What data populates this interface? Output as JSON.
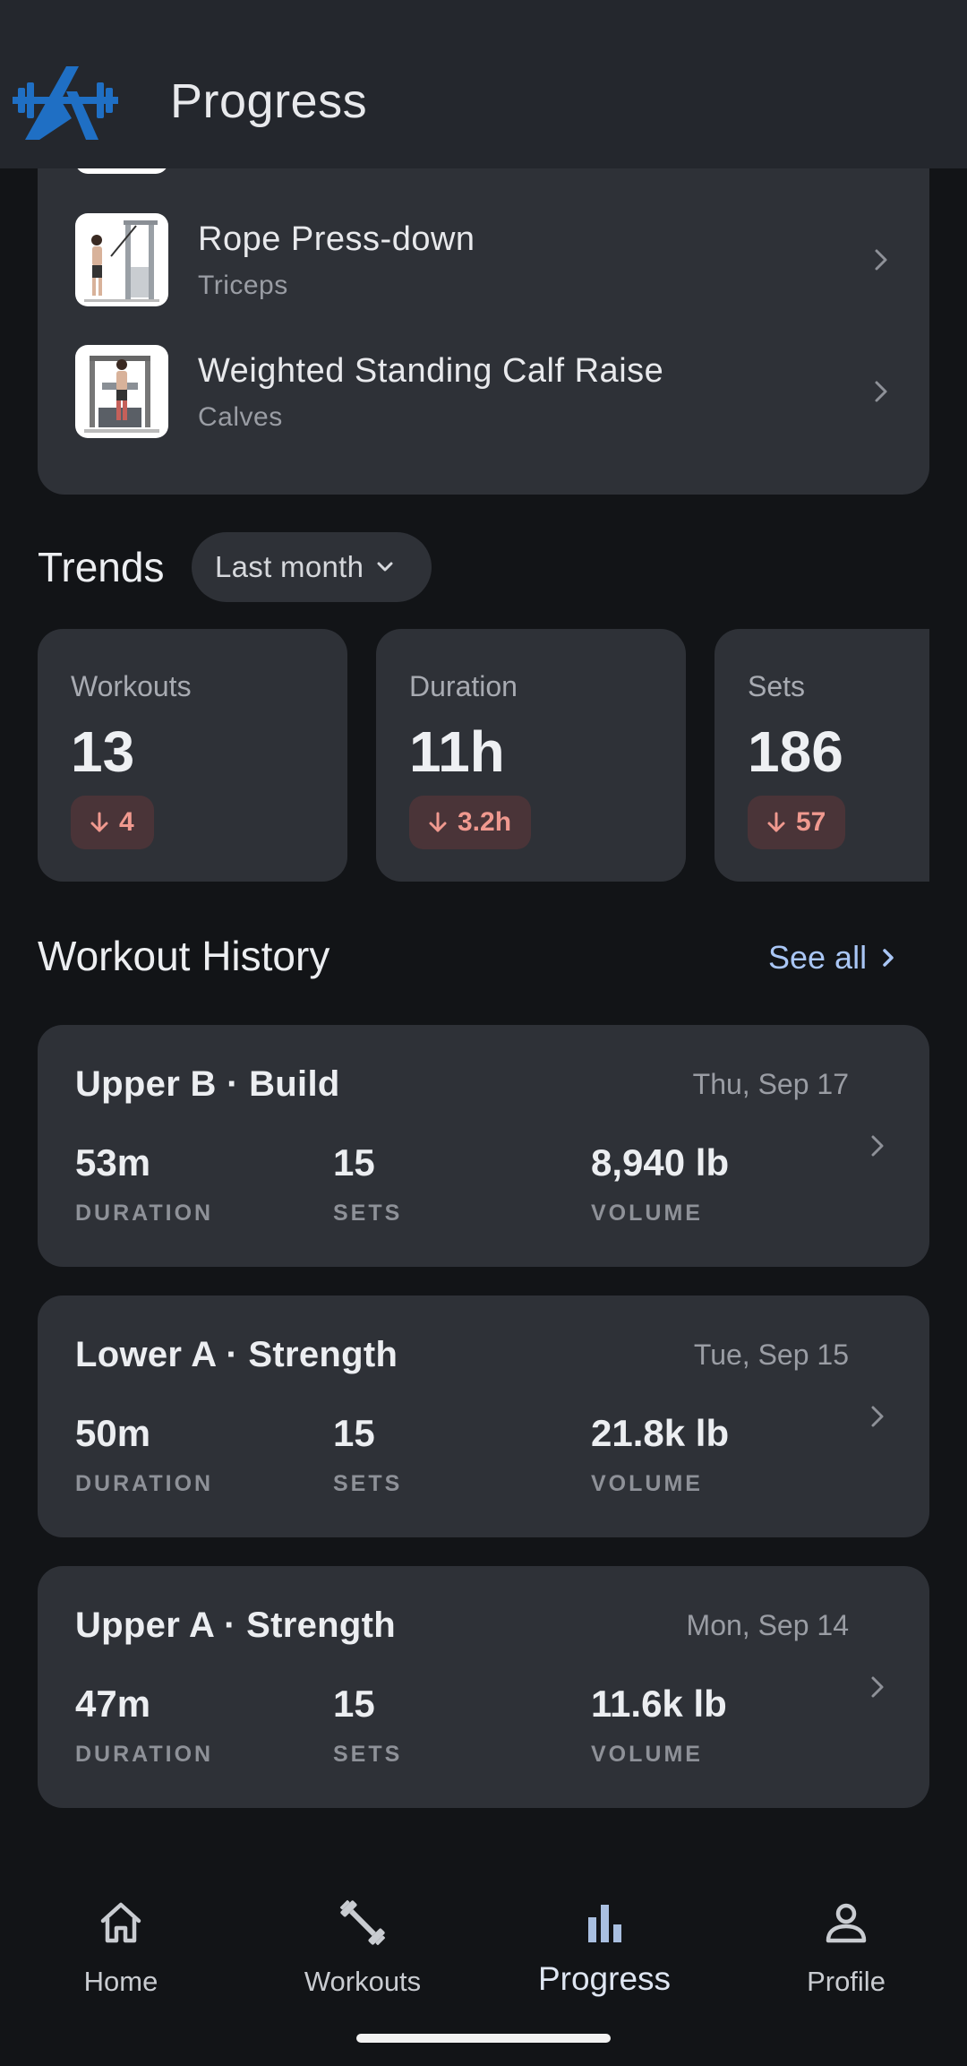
{
  "app": {
    "title": "Progress"
  },
  "exercises": [
    {
      "name": "Rope Press-down",
      "muscle": "Triceps"
    },
    {
      "name": "Weighted Standing Calf Raise",
      "muscle": "Calves"
    }
  ],
  "trends": {
    "title": "Trends",
    "range": "Last month",
    "stats": [
      {
        "label": "Workouts",
        "value": "13",
        "delta": "4",
        "direction": "down"
      },
      {
        "label": "Duration",
        "value": "11h",
        "delta": "3.2h",
        "direction": "down"
      },
      {
        "label": "Sets",
        "value": "186",
        "delta": "57",
        "direction": "down"
      }
    ]
  },
  "history": {
    "title": "Workout History",
    "see_all": "See all",
    "captions": {
      "duration": "DURATION",
      "sets": "SETS",
      "volume": "VOLUME"
    },
    "workouts": [
      {
        "name": "Upper B · Build",
        "date": "Thu, Sep 17",
        "duration": "53m",
        "sets": "15",
        "volume": "8,940 lb"
      },
      {
        "name": "Lower A · Strength",
        "date": "Tue, Sep 15",
        "duration": "50m",
        "sets": "15",
        "volume": "21.8k lb"
      },
      {
        "name": "Upper A · Strength",
        "date": "Mon, Sep 14",
        "duration": "47m",
        "sets": "15",
        "volume": "11.6k lb"
      }
    ]
  },
  "nav": {
    "items": [
      {
        "label": "Home",
        "icon": "home-icon"
      },
      {
        "label": "Workouts",
        "icon": "dumbbell-icon"
      },
      {
        "label": "Progress",
        "icon": "bar-chart-icon",
        "active": true
      },
      {
        "label": "Profile",
        "icon": "person-icon"
      }
    ]
  },
  "colors": {
    "brand": "#1f6fc4",
    "card": "#2e3137",
    "accent_link": "#a9c6f5",
    "delta_negative": "#f0998f"
  }
}
